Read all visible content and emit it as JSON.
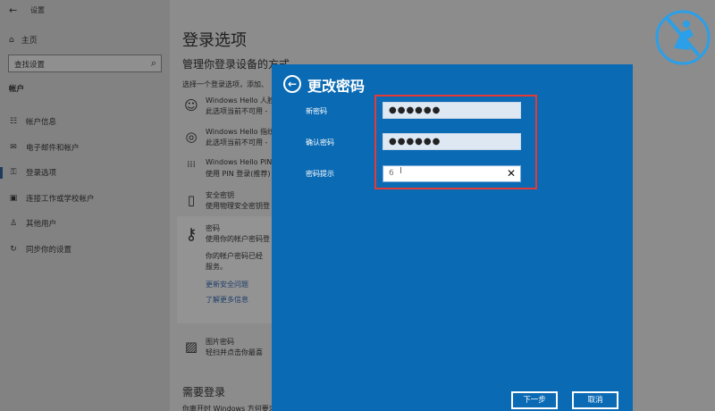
{
  "window": {
    "title": "设置"
  },
  "sidebar": {
    "home_label": "主页",
    "search_placeholder": "查找设置",
    "section_label": "帐户",
    "items": [
      {
        "icon": "person-card-icon",
        "glyph": "☷",
        "label": "帐户信息"
      },
      {
        "icon": "mail-icon",
        "glyph": "✉",
        "label": "电子邮件和帐户"
      },
      {
        "icon": "key-icon",
        "glyph": "⚿",
        "label": "登录选项",
        "active": true
      },
      {
        "icon": "briefcase-icon",
        "glyph": "▣",
        "label": "连接工作或学校帐户"
      },
      {
        "icon": "family-icon",
        "glyph": "♙",
        "label": "其他用户"
      },
      {
        "icon": "sync-icon",
        "glyph": "↻",
        "label": "同步你的设置"
      }
    ]
  },
  "main": {
    "title": "登录选项",
    "subtitle": "管理你登录设备的方式",
    "description": "选择一个登录选项，添加、",
    "options": [
      {
        "title": "Windows Hello 人脸",
        "desc": "此选项当前不可用 -",
        "glyph": "☺"
      },
      {
        "title": "Windows Hello 指纹",
        "desc": "此选项当前不可用 -",
        "glyph": "◎"
      },
      {
        "title": "Windows Hello PIN",
        "desc": "使用 PIN 登录(推荐)",
        "glyph": "⁞⁞⁞"
      },
      {
        "title": "安全密钥",
        "desc": "使用物理安全密钥登",
        "glyph": "▯"
      },
      {
        "title": "密码",
        "desc": "使用你的帐户密码登",
        "glyph": "⚷"
      }
    ],
    "password_more_1": "你的帐户密码已经",
    "password_more_2": "服务。",
    "link_security": "更新安全问题",
    "link_learn": "了解更多信息",
    "picture_password": {
      "title": "图片密码",
      "desc": "轻扫并点击你最喜"
    },
    "require_title": "需要登录",
    "require_sub": "你离开时 Windows 方何要求"
  },
  "dialog": {
    "title": "更改密码",
    "new_password_label": "新密码",
    "new_password_value": "●●●●●●",
    "confirm_label": "确认密码",
    "confirm_value": "●●●●●●",
    "hint_label": "密码提示",
    "hint_value": "6",
    "next_button": "下一步",
    "cancel_button": "取消"
  },
  "colors": {
    "dialog_bg": "#0a6ab4",
    "highlight": "#e53935",
    "link": "#1f3f6b"
  }
}
